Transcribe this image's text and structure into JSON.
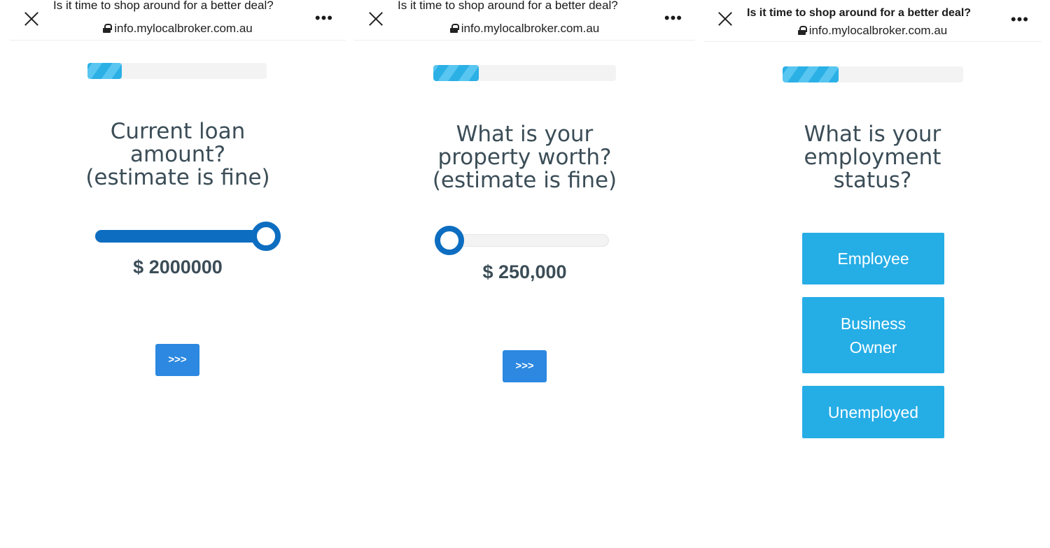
{
  "browser": {
    "page_title": "Is it time to shop around for a better deal?",
    "url": "info.mylocalbroker.com.au",
    "close_icon": "close-icon",
    "lock_icon": "lock-icon",
    "more_icon": "more-options-icon",
    "more_label": "•••"
  },
  "panels": [
    {
      "progress": 0.19,
      "question": "Current loan\namount?\n(estimate is fine)",
      "slider_value_text": "$ 2000000",
      "slider_fraction": 1.0,
      "next_label": ">>>"
    },
    {
      "progress": 0.25,
      "question": "What is your\nproperty worth?\n(estimate is fine)",
      "slider_value_text": "$ 250,000",
      "slider_fraction": 0.0,
      "next_label": ">>>"
    },
    {
      "progress": 0.31,
      "question": "What is your\nemployment\nstatus?",
      "options": [
        "Employee",
        "Business\nOwner",
        "Unemployed"
      ]
    }
  ],
  "colors": {
    "progress_stripe_a": "#2bb0e6",
    "progress_stripe_b": "#58c6f0",
    "slider_blue": "#0d6dc0",
    "next_button": "#2c88e0",
    "option_button": "#25ade6",
    "text": "#3b4d57"
  }
}
